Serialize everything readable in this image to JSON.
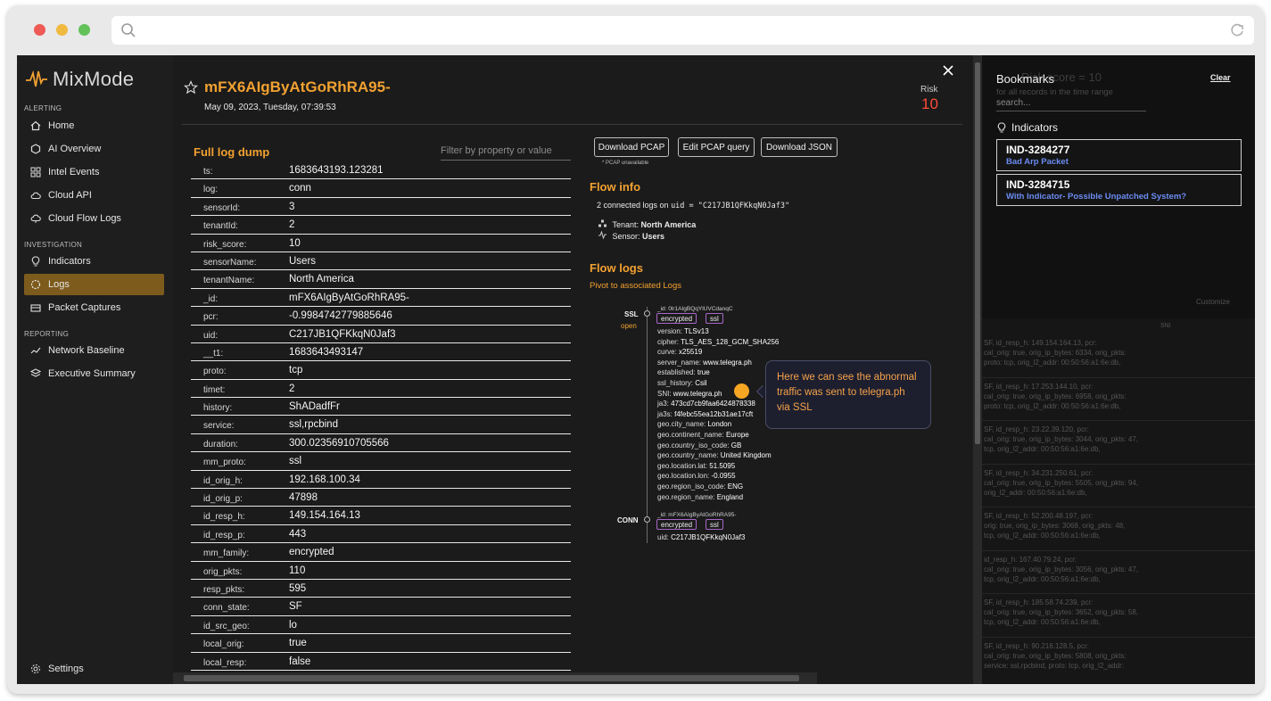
{
  "sidebar": {
    "brand": "MixMode",
    "sections": {
      "alerting": "ALERTING",
      "investigation": "INVESTIGATION",
      "reporting": "REPORTING"
    },
    "items": [
      {
        "label": "Home",
        "icon": "home-icon"
      },
      {
        "label": "AI Overview",
        "icon": "hexagon-icon"
      },
      {
        "label": "Intel Events",
        "icon": "grid-icon"
      },
      {
        "label": "Cloud API",
        "icon": "cloud-icon"
      },
      {
        "label": "Cloud Flow Logs",
        "icon": "cloud-flow-icon"
      },
      {
        "label": "Indicators",
        "icon": "lightbulb-icon"
      },
      {
        "label": "Logs",
        "icon": "logs-icon"
      },
      {
        "label": "Packet Captures",
        "icon": "packet-icon"
      },
      {
        "label": "Network Baseline",
        "icon": "trend-icon"
      },
      {
        "label": "Executive Summary",
        "icon": "layers-icon"
      }
    ],
    "active": "Logs",
    "settings": "Settings"
  },
  "detail": {
    "title": "mFX6AIgByAtGoRhRA95-",
    "date": "May 09, 2023, Tuesday, 07:39:53",
    "risk_label": "Risk",
    "risk_value": "10",
    "full_log_title": "Full log dump",
    "filter_placeholder": "Filter by property or value",
    "log_rows": [
      {
        "k": "ts:",
        "v": "1683643193.123281"
      },
      {
        "k": "log:",
        "v": "conn"
      },
      {
        "k": "sensorId:",
        "v": "3"
      },
      {
        "k": "tenantId:",
        "v": "2"
      },
      {
        "k": "risk_score:",
        "v": "10"
      },
      {
        "k": "sensorName:",
        "v": "Users"
      },
      {
        "k": "tenantName:",
        "v": "North America"
      },
      {
        "k": "_id:",
        "v": "mFX6AIgByAtGoRhRA95-"
      },
      {
        "k": "pcr:",
        "v": "-0.9984742779885646"
      },
      {
        "k": "uid:",
        "v": "C217JB1QFKkqN0Jaf3"
      },
      {
        "k": "__t1:",
        "v": "1683643493147"
      },
      {
        "k": "proto:",
        "v": "tcp"
      },
      {
        "k": "timet:",
        "v": "2"
      },
      {
        "k": "history:",
        "v": "ShADadfFr"
      },
      {
        "k": "service:",
        "v": "ssl,rpcbind"
      },
      {
        "k": "duration:",
        "v": "300.02356910705566"
      },
      {
        "k": "mm_proto:",
        "v": "ssl"
      },
      {
        "k": "id_orig_h:",
        "v": "192.168.100.34"
      },
      {
        "k": "id_orig_p:",
        "v": "47898"
      },
      {
        "k": "id_resp_h:",
        "v": "149.154.164.13"
      },
      {
        "k": "id_resp_p:",
        "v": "443"
      },
      {
        "k": "mm_family:",
        "v": "encrypted"
      },
      {
        "k": "orig_pkts:",
        "v": "110"
      },
      {
        "k": "resp_pkts:",
        "v": "595"
      },
      {
        "k": "conn_state:",
        "v": "SF"
      },
      {
        "k": "id_src_geo:",
        "v": "lo"
      },
      {
        "k": "local_orig:",
        "v": "true"
      },
      {
        "k": "local_resp:",
        "v": "false"
      }
    ],
    "buttons": {
      "download_pcap": "Download PCAP",
      "edit_pcap": "Edit PCAP query",
      "download_json": "Download JSON"
    },
    "pcap_note": "* PCAP unavailable",
    "flow_info": {
      "title": "Flow info",
      "connected_prefix": "2 connected logs on ",
      "connected_code": "uid = \"C217JB1QFKkqN0Jaf3\"",
      "tenant_label": "Tenant: ",
      "tenant_value": "North America",
      "sensor_label": "Sensor: ",
      "sensor_value": "Users"
    },
    "flow_logs": {
      "title": "Flow logs",
      "pivot": "Pivot to associated Logs",
      "ssl": {
        "label": "SSL",
        "status": "open",
        "id": "_id: 0lr1AIgBQqYlUVCdanqC",
        "tags": [
          "encrypted",
          "ssl"
        ],
        "fields": [
          {
            "k": "version: ",
            "v": "TLSv13"
          },
          {
            "k": "cipher: ",
            "v": "TLS_AES_128_GCM_SHA256"
          },
          {
            "k": "curve: ",
            "v": "x25519"
          },
          {
            "k": "server_name: ",
            "v": "www.telegra.ph"
          },
          {
            "k": "established: ",
            "v": "true"
          },
          {
            "k": "ssl_history: ",
            "v": "Csil"
          },
          {
            "k": "SNI: ",
            "v": "www.telegra.ph"
          },
          {
            "k": "ja3: ",
            "v": "473cd7cb9faa6424878338"
          },
          {
            "k": "ja3s: ",
            "v": "f4febc55ea12b31ae17cft"
          },
          {
            "k": "geo.city_name: ",
            "v": "London"
          },
          {
            "k": "geo.continent_name: ",
            "v": "Europe"
          },
          {
            "k": "geo.country_iso_code: ",
            "v": "GB"
          },
          {
            "k": "geo.country_name: ",
            "v": "United Kingdom"
          },
          {
            "k": "geo.location.lat: ",
            "v": "51.5095"
          },
          {
            "k": "geo.location.lon: ",
            "v": "-0.0955"
          },
          {
            "k": "geo.region_iso_code: ",
            "v": "ENG"
          },
          {
            "k": "geo.region_name: ",
            "v": "England"
          }
        ]
      },
      "conn": {
        "label": "CONN",
        "id": "_id: mFX6AIgByAtGoRhRA95-",
        "tags": [
          "encrypted",
          "ssl"
        ],
        "uid_label": "uid: ",
        "uid_value": "C217JB1QFKkqN0Jaf3"
      }
    },
    "callout": "Here we can see the abnormal traffic was sent to telegra.ph via SSL"
  },
  "bookmarks": {
    "title": "Bookmarks",
    "clear": "Clear",
    "search_placeholder": "search...",
    "indicators_title": "Indicators",
    "items": [
      {
        "id": "IND-3284277",
        "desc": "Bad Arp Packet"
      },
      {
        "id": "IND-3284715",
        "desc": "With Indicator- Possible Unpatched System?"
      }
    ],
    "ghost": {
      "score": "Risk score = 10",
      "range": "for all records in the time range",
      "customize": "Customize",
      "col": "SNI",
      "rows": [
        {
          "a": "SF, id_resp_h: 149.154.164.13, pcr:",
          "b": "cal_orig: true, orig_ip_bytes: 6334, orig_pkts:",
          "c": "proto: tcp, orig_l2_addr: 00:50:56:a1:6e:db,"
        },
        {
          "a": "SF, id_resp_h: 17.253.144.10, pcr:",
          "b": "cal_orig: true, orig_ip_bytes: 6958, orig_pkts:",
          "c": "proto: tcp, orig_l2_addr: 00:50:56:a1:6e:db,"
        },
        {
          "a": "SF, id_resp_h: 23.22.39.120, pcr:",
          "b": "cal_orig: true, orig_ip_bytes: 3044, orig_pkts: 47,",
          "c": "tcp, orig_l2_addr: 00:50:56:a1:6e:db,"
        },
        {
          "a": "SF, id_resp_h: 34.231.250.61, pcr:",
          "b": "cal_orig: true, orig_ip_bytes: 5505, orig_pkts: 94,",
          "c": "orig_l2_addr: 00:50:56:a1:6e:db,"
        },
        {
          "a": "SF, id_resp_h: 52.200.48.197, pcr:",
          "b": "orig: true, orig_ip_bytes: 3068, orig_pkts: 48,",
          "c": "tcp, orig_l2_addr: 00:50:56:a1:6e:db,"
        },
        {
          "a": "id_resp_h: 167.40.79.24, pcr:",
          "b": "cal_orig: true, orig_ip_bytes: 3056, orig_pkts: 47,",
          "c": "tcp, orig_l2_addr: 00:50:56:a1:6e:db,"
        },
        {
          "a": "SF, id_resp_h: 185.58.74.239, pcr:",
          "b": "cal_orig: true, orig_ip_bytes: 3652, orig_pkts: 58,",
          "c": "tcp, orig_l2_addr: 00:50:56:a1:6e:db,"
        },
        {
          "a": "SF, id_resp_h: 90.216.128.5, pcr:",
          "b": "cal_orig: true, orig_ip_bytes: 5808, orig_pkts:",
          "c": "service: ssl,rpcbind, proto: tcp, orig_l2_addr:"
        }
      ]
    }
  },
  "colors": {
    "accent": "#f2a131",
    "risk": "#ff4b3a",
    "link": "#6b8cf2",
    "active_nav": "#7d5b1d",
    "tag_border": "#a867c8"
  }
}
